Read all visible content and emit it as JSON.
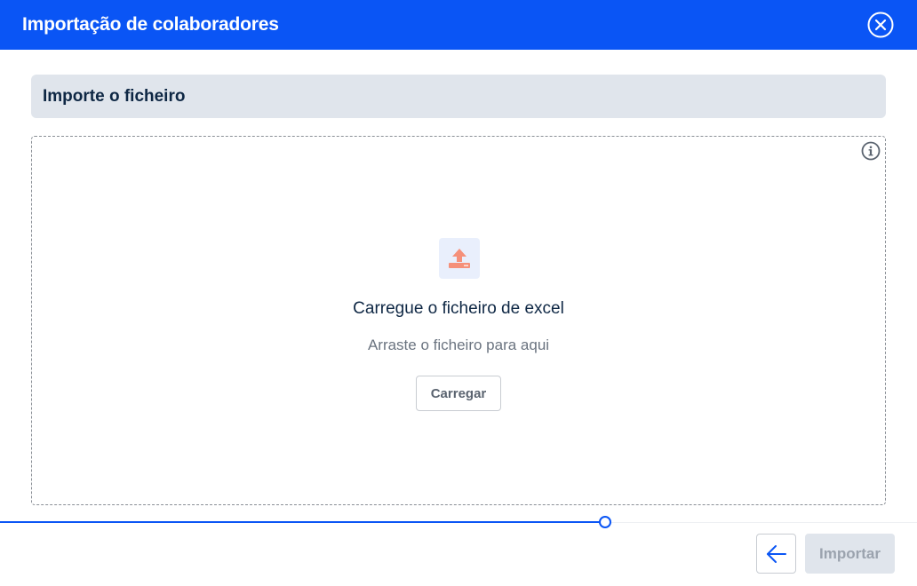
{
  "header": {
    "title": "Importação de colaboradores",
    "close_icon": "close-circle-icon"
  },
  "section": {
    "title": "Importe o ficheiro"
  },
  "dropzone": {
    "info_icon": "info-circle-icon",
    "upload_icon": "upload-tray-icon",
    "title": "Carregue o ficheiro de excel",
    "subtitle": "Arraste o ficheiro para aqui",
    "upload_button_label": "Carregar"
  },
  "footer": {
    "progress_fraction": 0.66,
    "back_icon": "arrow-left-icon",
    "import_button_label": "Importar",
    "import_button_disabled": true
  },
  "colors": {
    "brand": "#0a55f5",
    "section_bg": "#e0e5ec",
    "title_text": "#0e2744",
    "upload_icon": "#f5907a"
  }
}
